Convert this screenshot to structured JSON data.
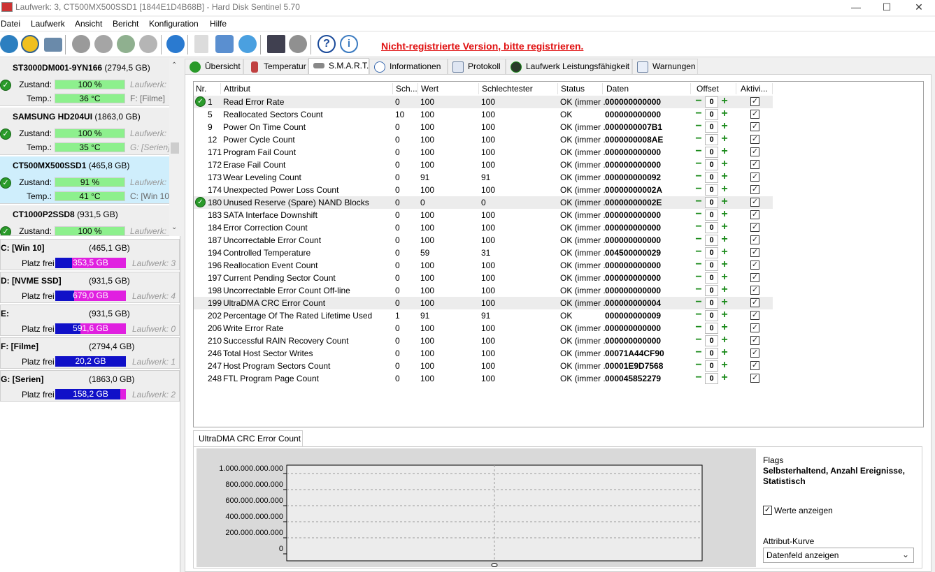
{
  "window": {
    "title": "Laufwerk: 3, CT500MX500SSD1 [1844E1D4B68B]  -  Hard Disk Sentinel 5.70",
    "minimize": "—",
    "maximize": "☐",
    "close": "✕"
  },
  "menu": [
    "Datei",
    "Laufwerk",
    "Ansicht",
    "Bericht",
    "Konfiguration",
    "Hilfe"
  ],
  "toolbar": {
    "register_link": "Nicht-registrierte Version, bitte registrieren."
  },
  "disks": [
    {
      "name": "ST3000DM001-9YN166",
      "size": "(2794,5 GB)",
      "zustand_label": "Zustand:",
      "zustand": "100 %",
      "temp_label": "Temp.:",
      "temp": "36 °C",
      "info1": "Laufwerk:",
      "info2": "F: [Filme]"
    },
    {
      "name": "SAMSUNG HD204UI",
      "size": "(1863,0 GB)",
      "zustand_label": "Zustand:",
      "zustand": "100 %",
      "temp_label": "Temp.:",
      "temp": "35 °C",
      "info1": "Laufwerk:",
      "info2": "G: [Serien]"
    },
    {
      "name": "CT500MX500SSD1",
      "size": "(465,8 GB)",
      "zustand_label": "Zustand:",
      "zustand": "91 %",
      "temp_label": "Temp.:",
      "temp": "41 °C",
      "info1": "Laufwerk:",
      "info2": "C: [Win 10]"
    },
    {
      "name": "CT1000P2SSD8",
      "size": "(931,5 GB)",
      "zustand_label": "Zustand:",
      "zustand": "100 %",
      "info1": "Laufwerk:"
    }
  ],
  "volumes": [
    {
      "name": "C: [Win 10]",
      "size": "(465,1 GB)",
      "label": "Platz frei",
      "free": "353,5 GB",
      "free_ratio": 0.76,
      "drive": "Laufwerk: 3"
    },
    {
      "name": "D: [NVME SSD]",
      "size": "(931,5 GB)",
      "label": "Platz frei",
      "free": "679,0 GB",
      "free_ratio": 0.73,
      "drive": "Laufwerk: 4"
    },
    {
      "name": "E:",
      "size": "(931,5 GB)",
      "label": "Platz frei",
      "free": "591,6 GB",
      "free_ratio": 0.64,
      "drive": "Laufwerk: 0"
    },
    {
      "name": "F: [Filme]",
      "size": "(2794,4 GB)",
      "label": "Platz frei",
      "free": "20,2 GB",
      "free_ratio": 0.0,
      "drive": "Laufwerk: 1"
    },
    {
      "name": "G: [Serien]",
      "size": "(1863,0 GB)",
      "label": "Platz frei",
      "free": "158,2 GB",
      "free_ratio": 0.08,
      "drive": "Laufwerk: 2"
    }
  ],
  "tabs": [
    "Übersicht",
    "Temperatur",
    "S.M.A.R.T.",
    "Informationen",
    "Protokoll",
    "Laufwerk Leistungsfähigkeit",
    "Warnungen"
  ],
  "smart": {
    "headers": [
      "Nr.",
      "Attribut",
      "Sch...",
      "Wert",
      "Schlechtester",
      "Status",
      "Daten",
      "Offset",
      "Aktivi..."
    ],
    "rows": [
      {
        "nr": "1",
        "attr": "Read Error Rate",
        "sch": "0",
        "wert": "100",
        "worst": "100",
        "status": "OK (immer ...",
        "daten": "000000000000",
        "offset": "0",
        "ok": true,
        "hl": true
      },
      {
        "nr": "5",
        "attr": "Reallocated Sectors Count",
        "sch": "10",
        "wert": "100",
        "worst": "100",
        "status": "OK",
        "daten": "000000000000",
        "offset": "0"
      },
      {
        "nr": "9",
        "attr": "Power On Time Count",
        "sch": "0",
        "wert": "100",
        "worst": "100",
        "status": "OK (immer ...",
        "daten": "0000000007B1",
        "offset": "0"
      },
      {
        "nr": "12",
        "attr": "Power Cycle Count",
        "sch": "0",
        "wert": "100",
        "worst": "100",
        "status": "OK (immer ...",
        "daten": "0000000008AE",
        "offset": "0"
      },
      {
        "nr": "171",
        "attr": "Program Fail Count",
        "sch": "0",
        "wert": "100",
        "worst": "100",
        "status": "OK (immer ...",
        "daten": "000000000000",
        "offset": "0"
      },
      {
        "nr": "172",
        "attr": "Erase Fail Count",
        "sch": "0",
        "wert": "100",
        "worst": "100",
        "status": "OK (immer ...",
        "daten": "000000000000",
        "offset": "0"
      },
      {
        "nr": "173",
        "attr": "Wear Leveling Count",
        "sch": "0",
        "wert": "91",
        "worst": "91",
        "status": "OK (immer ...",
        "daten": "000000000092",
        "offset": "0"
      },
      {
        "nr": "174",
        "attr": "Unexpected Power Loss Count",
        "sch": "0",
        "wert": "100",
        "worst": "100",
        "status": "OK (immer ...",
        "daten": "00000000002A",
        "offset": "0"
      },
      {
        "nr": "180",
        "attr": "Unused Reserve (Spare) NAND Blocks",
        "sch": "0",
        "wert": "0",
        "worst": "0",
        "status": "OK (immer ...",
        "daten": "00000000002E",
        "offset": "0",
        "ok": true,
        "hl": true
      },
      {
        "nr": "183",
        "attr": "SATA Interface Downshift",
        "sch": "0",
        "wert": "100",
        "worst": "100",
        "status": "OK (immer ...",
        "daten": "000000000000",
        "offset": "0"
      },
      {
        "nr": "184",
        "attr": "Error Correction Count",
        "sch": "0",
        "wert": "100",
        "worst": "100",
        "status": "OK (immer ...",
        "daten": "000000000000",
        "offset": "0"
      },
      {
        "nr": "187",
        "attr": "Uncorrectable Error Count",
        "sch": "0",
        "wert": "100",
        "worst": "100",
        "status": "OK (immer ...",
        "daten": "000000000000",
        "offset": "0"
      },
      {
        "nr": "194",
        "attr": "Controlled Temperature",
        "sch": "0",
        "wert": "59",
        "worst": "31",
        "status": "OK (immer ...",
        "daten": "004500000029",
        "offset": "0"
      },
      {
        "nr": "196",
        "attr": "Reallocation Event Count",
        "sch": "0",
        "wert": "100",
        "worst": "100",
        "status": "OK (immer ...",
        "daten": "000000000000",
        "offset": "0"
      },
      {
        "nr": "197",
        "attr": "Current Pending Sector Count",
        "sch": "0",
        "wert": "100",
        "worst": "100",
        "status": "OK (immer ...",
        "daten": "000000000000",
        "offset": "0"
      },
      {
        "nr": "198",
        "attr": "Uncorrectable Error Count Off-line",
        "sch": "0",
        "wert": "100",
        "worst": "100",
        "status": "OK (immer ...",
        "daten": "000000000000",
        "offset": "0"
      },
      {
        "nr": "199",
        "attr": "UltraDMA CRC Error Count",
        "sch": "0",
        "wert": "100",
        "worst": "100",
        "status": "OK (immer ...",
        "daten": "000000000004",
        "offset": "0",
        "hl": true
      },
      {
        "nr": "202",
        "attr": "Percentage Of The Rated Lifetime Used",
        "sch": "1",
        "wert": "91",
        "worst": "91",
        "status": "OK",
        "daten": "000000000009",
        "offset": "0"
      },
      {
        "nr": "206",
        "attr": "Write Error Rate",
        "sch": "0",
        "wert": "100",
        "worst": "100",
        "status": "OK (immer ...",
        "daten": "000000000000",
        "offset": "0"
      },
      {
        "nr": "210",
        "attr": "Successful RAIN Recovery Count",
        "sch": "0",
        "wert": "100",
        "worst": "100",
        "status": "OK (immer ...",
        "daten": "000000000000",
        "offset": "0"
      },
      {
        "nr": "246",
        "attr": "Total Host Sector Writes",
        "sch": "0",
        "wert": "100",
        "worst": "100",
        "status": "OK (immer ...",
        "daten": "00071A44CF90",
        "offset": "0"
      },
      {
        "nr": "247",
        "attr": "Host Program Sectors Count",
        "sch": "0",
        "wert": "100",
        "worst": "100",
        "status": "OK (immer ...",
        "daten": "00001E9D7568",
        "offset": "0"
      },
      {
        "nr": "248",
        "attr": "FTL Program Page Count",
        "sch": "0",
        "wert": "100",
        "worst": "100",
        "status": "OK (immer ...",
        "daten": "000045852279",
        "offset": "0"
      }
    ]
  },
  "graph": {
    "tab_label": "UltraDMA CRC Error Count",
    "y_labels": [
      "1.000.000.000.000",
      "800.000.000.000",
      "600.000.000.000",
      "400.000.000.000",
      "200.000.000.000",
      "0"
    ]
  },
  "side": {
    "flags_label": "Flags",
    "flags_value": "Selbsterhaltend, Anzahl Ereignisse, Statistisch",
    "werte_label": "Werte anzeigen",
    "kurve_label": "Attribut-Kurve",
    "kurve_value": "Datenfeld anzeigen"
  }
}
